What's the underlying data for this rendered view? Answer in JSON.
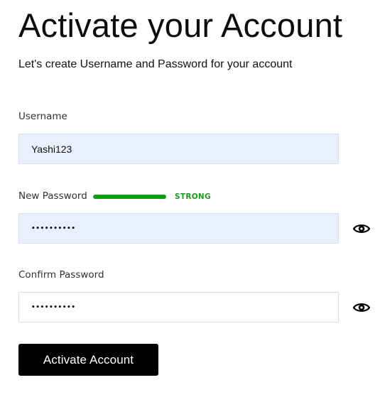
{
  "header": {
    "title": "Activate your Account",
    "subtitle": "Let's create Username and Password for your account"
  },
  "form": {
    "username": {
      "label": "Username",
      "value": "Yashi123"
    },
    "new_password": {
      "label": "New Password",
      "masked_value": "••••••••••",
      "strength": {
        "label": "STRONG",
        "level": 1.0,
        "color": "#0a9e0a"
      },
      "toggle_icon": "eye-icon"
    },
    "confirm_password": {
      "label": "Confirm Password",
      "masked_value": "••••••••••",
      "toggle_icon": "eye-icon"
    },
    "submit_label": "Activate Account"
  },
  "colors": {
    "autofill_background": "#e8f0fe",
    "button_background": "#000000",
    "strength_strong": "#0a9e0a"
  }
}
